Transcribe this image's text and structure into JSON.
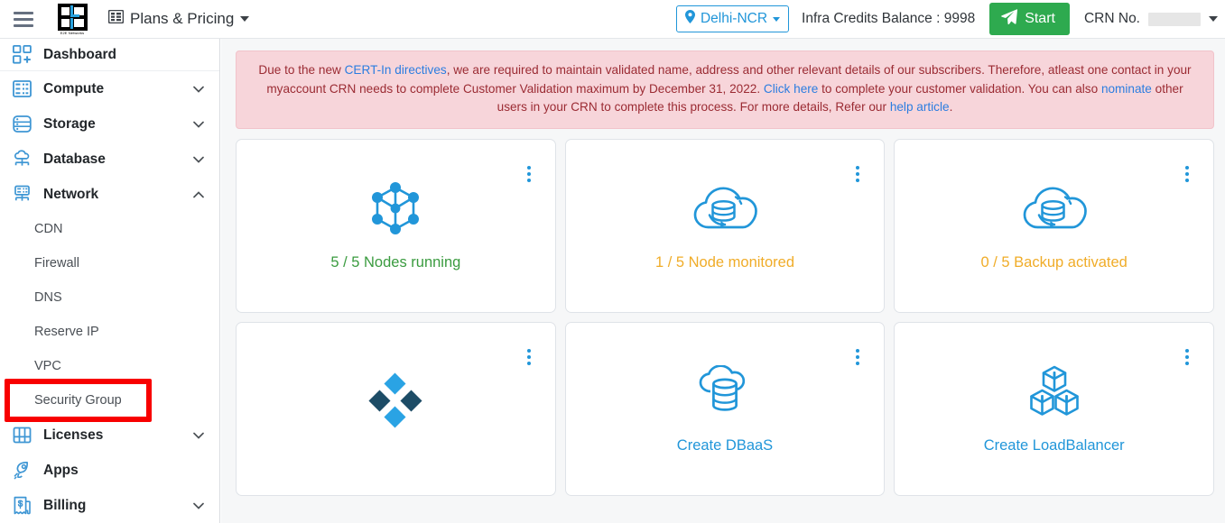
{
  "header": {
    "menu_icon": "hamburger-icon",
    "logo": {
      "icon": "e2e-networks-logo",
      "text": "E2E Networks"
    },
    "plans": {
      "icon": "list-icon",
      "label": "Plans & Pricing",
      "caret": "chevron-down-icon"
    },
    "region": {
      "icon": "location-pin-icon",
      "label": "Delhi-NCR",
      "caret": "chevron-down-icon"
    },
    "credits_label": "Infra Credits Balance : 9998",
    "start_button": {
      "icon": "send-icon",
      "label": "Start"
    },
    "crn": {
      "label": "CRN No.",
      "value": "",
      "caret": "chevron-down-icon"
    }
  },
  "sidebar": {
    "items": [
      {
        "label": "Dashboard",
        "icon": "dashboard-grid-icon",
        "expandable": false,
        "expanded": false
      },
      {
        "label": "Compute",
        "icon": "server-rack-icon",
        "expandable": true,
        "expanded": false
      },
      {
        "label": "Storage",
        "icon": "database-disk-icon",
        "expandable": true,
        "expanded": false
      },
      {
        "label": "Database",
        "icon": "cloud-database-icon",
        "expandable": true,
        "expanded": false
      },
      {
        "label": "Network",
        "icon": "network-node-icon",
        "expandable": true,
        "expanded": true
      }
    ],
    "network_sub_items": [
      {
        "label": "CDN",
        "highlighted": false
      },
      {
        "label": "Firewall",
        "highlighted": false
      },
      {
        "label": "DNS",
        "highlighted": false
      },
      {
        "label": "Reserve IP",
        "highlighted": false
      },
      {
        "label": "VPC",
        "highlighted": false
      },
      {
        "label": "Security Group",
        "highlighted": true
      }
    ],
    "bottom_items": [
      {
        "label": "Licenses",
        "icon": "license-window-icon",
        "expandable": true
      },
      {
        "label": "Apps",
        "icon": "rocket-icon",
        "expandable": false
      },
      {
        "label": "Billing",
        "icon": "money-bill-icon",
        "expandable": true
      }
    ],
    "highlight_color": "#f80000"
  },
  "banner": {
    "part1": "Due to the new ",
    "link1": "CERT-In directives",
    "part2": ", we are required to maintain validated name, address and other relevant details of our subscribers. Therefore, atleast one contact in your myaccount CRN needs to complete Customer Validation maximum by December 31, 2022. ",
    "link2": "Click here",
    "part3": " to complete your customer validation. You can also ",
    "link3": "nominate",
    "part4": " other users in your CRN to complete this process. For more details, Refer our ",
    "link4": "help article",
    "part5": "."
  },
  "cards": [
    {
      "icon": "node-cube-network-icon",
      "label": "5 / 5 Nodes running",
      "label_color": "#3a9b3f",
      "color_class": "label-green",
      "menu": "kebab-menu-icon"
    },
    {
      "icon": "cloud-monitor-db-icon",
      "label": "1 / 5 Node monitored",
      "label_color": "#f0ac28",
      "color_class": "label-amber",
      "menu": "kebab-menu-icon"
    },
    {
      "icon": "cloud-backup-db-icon",
      "label": "0 / 5 Backup activated",
      "label_color": "#f0ac28",
      "color_class": "label-amber",
      "menu": "kebab-menu-icon"
    },
    {
      "icon": "loading-spinner-icon",
      "label": "",
      "label_color": "",
      "color_class": "",
      "menu": "kebab-menu-icon"
    },
    {
      "icon": "cloud-database-icon",
      "label": "Create DBaaS",
      "label_color": "#2196d9",
      "color_class": "label-blue",
      "menu": "kebab-menu-icon"
    },
    {
      "icon": "stacked-cubes-icon",
      "label": "Create LoadBalancer",
      "label_color": "#2196d9",
      "color_class": "label-blue",
      "menu": "kebab-menu-icon"
    }
  ],
  "colors": {
    "accent_blue": "#2196d9",
    "success_green": "#2eaa4f",
    "warning_amber": "#f0ac28",
    "banner_bg": "#f7d5da",
    "banner_text": "#9b2b33",
    "link_blue": "#2b7de0"
  }
}
